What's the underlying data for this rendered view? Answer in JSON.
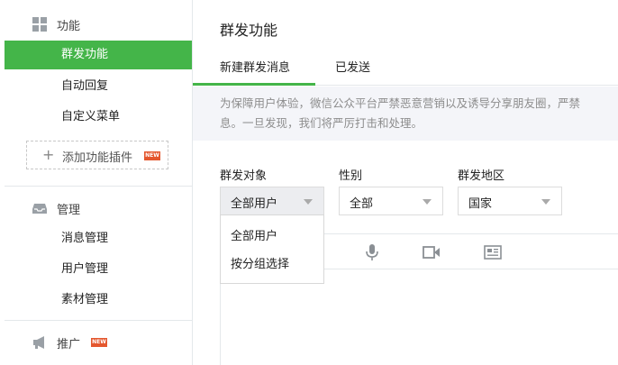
{
  "sidebar": {
    "section_features": {
      "label": "功能",
      "icon": "grid-icon"
    },
    "items_features": [
      {
        "label": "群发功能",
        "active": true
      },
      {
        "label": "自动回复",
        "active": false
      },
      {
        "label": "自定义菜单",
        "active": false
      }
    ],
    "add_plugin": {
      "label": "添加功能插件",
      "badge": "NEW"
    },
    "section_manage": {
      "label": "管理",
      "icon": "inbox-icon"
    },
    "items_manage": [
      {
        "label": "消息管理"
      },
      {
        "label": "用户管理"
      },
      {
        "label": "素材管理"
      }
    ],
    "section_promote": {
      "label": "推广",
      "icon": "megaphone-icon",
      "badge": "NEW"
    }
  },
  "main": {
    "title": "群发功能",
    "tabs": [
      {
        "label": "新建群发消息",
        "active": true
      },
      {
        "label": "已发送",
        "active": false
      }
    ],
    "notice": {
      "line1": "为保障用户体验，微信公众平台严禁恶意营销以及诱导分享朋友圈，严禁",
      "line2": "息。一旦发现，我们将严厉打击和处理。"
    },
    "filters": {
      "target": {
        "label": "群发对象",
        "value": "全部用户",
        "options": [
          "全部用户",
          "按分组选择"
        ]
      },
      "gender": {
        "label": "性别",
        "value": "全部"
      },
      "region": {
        "label": "群发地区",
        "value": "国家"
      }
    },
    "editor_tools": [
      "voice-icon",
      "video-icon",
      "news-icon"
    ]
  },
  "colors": {
    "accent": "#44b549",
    "badge": "#e4572e",
    "notice_bg": "#f4f5f9"
  }
}
